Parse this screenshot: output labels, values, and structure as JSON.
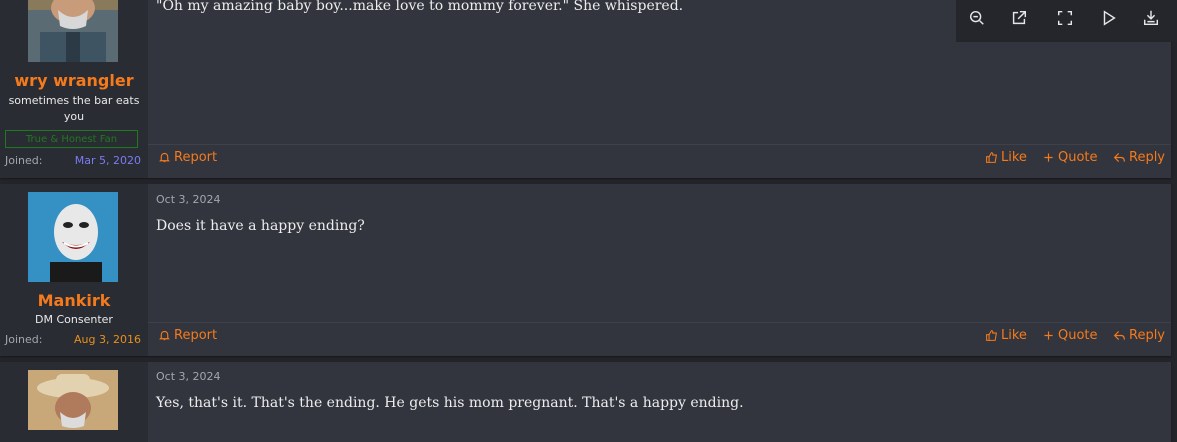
{
  "posts": [
    {
      "username": "wry wrangler",
      "user_title": "sometimes the bar eats you",
      "banner": "True & Honest Fan",
      "joined_label": "Joined:",
      "joined_date": "Mar 5, 2020",
      "message": "\"Oh my amazing baby boy...make love to mommy forever.\" She whispered.",
      "actions": {
        "report": "Report",
        "like": "Like",
        "quote": "Quote",
        "reply": "Reply"
      }
    },
    {
      "date": "Oct 3, 2024",
      "username": "Mankirk",
      "user_title": "DM Consenter",
      "joined_label": "Joined:",
      "joined_date": "Aug 3, 2016",
      "message": "Does it have a happy ending?",
      "actions": {
        "report": "Report",
        "like": "Like",
        "quote": "Quote",
        "reply": "Reply"
      }
    },
    {
      "date": "Oct 3, 2024",
      "message": "Yes, that's it. That's the ending. He gets his mom pregnant. That's a happy ending."
    }
  ],
  "colors": {
    "accent": "#f57a1c",
    "joined_date_1": "#7b7bf0",
    "joined_date_2": "#e8901c"
  },
  "toolbar_icons": [
    "zoom-out-icon",
    "open-external-icon",
    "fullscreen-icon",
    "play-icon",
    "download-icon"
  ]
}
